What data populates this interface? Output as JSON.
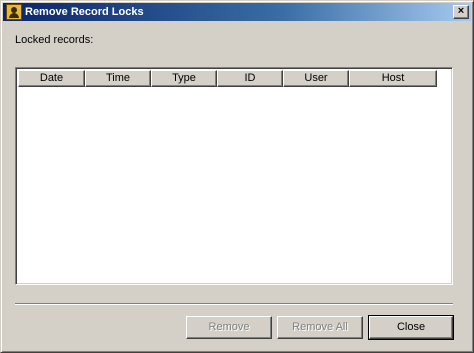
{
  "window": {
    "title": "Remove Record Locks",
    "close_glyph": "×"
  },
  "locked_records_label": "Locked records:",
  "table": {
    "columns": [
      "Date",
      "Time",
      "Type",
      "ID",
      "User",
      "Host"
    ],
    "rows": []
  },
  "buttons": {
    "remove": "Remove",
    "remove_all": "Remove All",
    "close": "Close"
  },
  "icons": {
    "app": "user-lock-icon",
    "close": "close-icon"
  },
  "colors": {
    "titlebar_start": "#0a246a",
    "titlebar_end": "#a6caf0",
    "face": "#d4d0c8"
  }
}
